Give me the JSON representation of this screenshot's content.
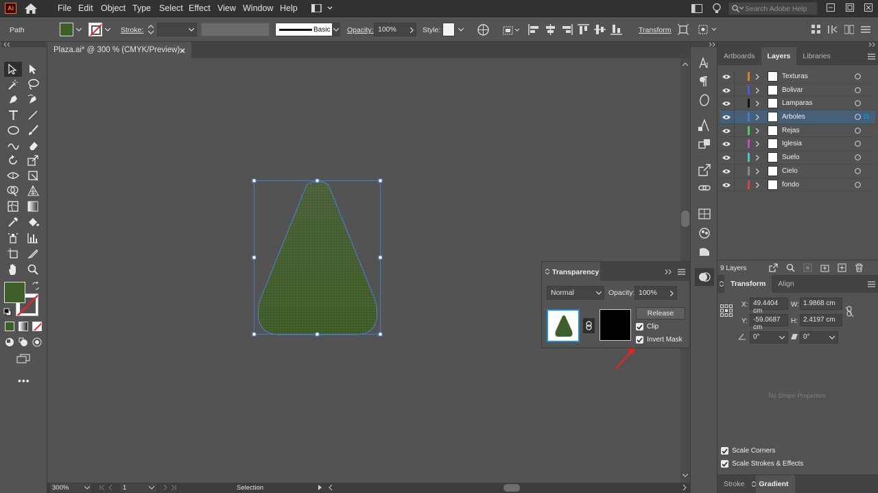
{
  "app": {
    "logo": "Ai"
  },
  "menus": [
    "File",
    "Edit",
    "Object",
    "Type",
    "Select",
    "Effect",
    "View",
    "Window",
    "Help"
  ],
  "search": {
    "placeholder": "Search Adobe Help"
  },
  "control": {
    "object_type": "Path",
    "stroke_label": "Stroke:",
    "brush_label": "Basic",
    "opacity_label": "Opacity:",
    "opacity_value": "100%",
    "style_label": "Style:",
    "transform_label": "Transform"
  },
  "document": {
    "tab_title": "Plaza.ai* @ 300 % (CMYK/Preview)"
  },
  "status": {
    "zoom": "300%",
    "artboard": "1",
    "tool": "Selection"
  },
  "colors": {
    "fill": "#3f5f2a",
    "accent": "#1b8ee0",
    "selection_blue": "#4a7ac6"
  },
  "panels": {
    "tabs": [
      "Artboards",
      "Layers",
      "Libraries"
    ],
    "active_tab": "Layers",
    "layers_count": "9 Layers",
    "layers": [
      {
        "name": "Texturas",
        "color": "#e8772e"
      },
      {
        "name": "Bolivar",
        "color": "#4a5fd0"
      },
      {
        "name": "Lamparas",
        "color": "#111111"
      },
      {
        "name": "Arboles",
        "color": "#4a7ac6"
      },
      {
        "name": "Rejas",
        "color": "#5ac85a"
      },
      {
        "name": "Iglesia",
        "color": "#c84ac8"
      },
      {
        "name": "Suelo",
        "color": "#45c8c8"
      },
      {
        "name": "Cielo",
        "color": "#8a8a8a"
      },
      {
        "name": "fondo",
        "color": "#d84545"
      }
    ],
    "selected_layer": "Arboles",
    "transform_tabs": [
      "Transform",
      "Align"
    ],
    "transform": {
      "x_label": "X:",
      "x": "49.4404 cm",
      "y_label": "Y:",
      "y": "-59.0687 cm",
      "w_label": "W:",
      "w": "1.9868 cm",
      "h_label": "H:",
      "h": "2.4197 cm",
      "rotate": "0°",
      "shear": "0°"
    },
    "no_shape": "No Shape Properties",
    "scale_corners": "Scale Corners",
    "scale_strokes": "Scale Strokes & Effects",
    "bottom_tabs": [
      "Stroke",
      "Gradient"
    ]
  },
  "transparency": {
    "title": "Transparency",
    "blend_mode": "Normal",
    "opacity_label": "Opacity:",
    "opacity": "100%",
    "release": "Release",
    "clip": "Clip",
    "invert_mask": "Invert Mask",
    "clip_checked": true,
    "invert_checked": true
  }
}
